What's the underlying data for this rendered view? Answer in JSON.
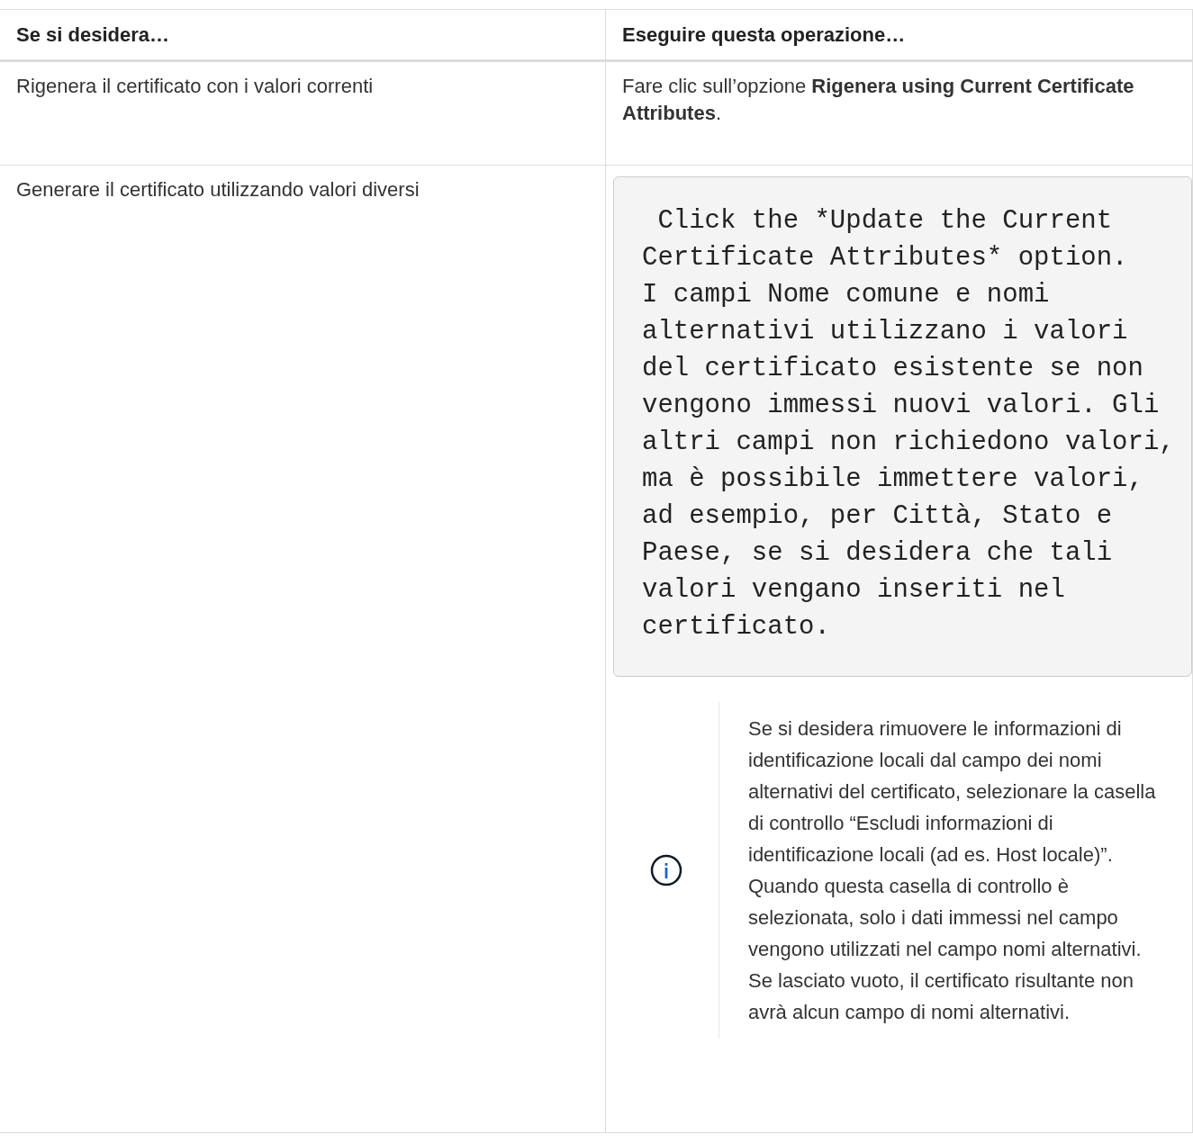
{
  "table": {
    "columns": [
      "Se si desidera…",
      "Eseguire questa operazione…"
    ],
    "rows": [
      {
        "action": "Rigenera il certificato con i valori correnti",
        "instruction": "Fare clic sull’opzione **Rigenera using Current Certificate Attributes**."
      },
      {
        "action": "Generare il certificato utilizzando valori diversi",
        "code": " Click the *Update the Current Certificate Attributes* option.\nI campi Nome comune e nomi alternativi utilizzano i valori del certificato esistente se non vengono immessi nuovi valori. Gli altri campi non richiedono valori, ma è possibile immettere valori, ad esempio, per Città, Stato e Paese, se si desidera che tali valori vengano inseriti nel certificato.",
        "note": "Se si desidera rimuovere le informazioni di identificazione locali dal campo dei nomi alternativi del certificato, selezionare la casella di controllo “Escludi informazioni di identificazione locali (ad es. Host locale)”. Quando questa casella di controllo è selezionata, solo i dati immessi nel campo vengono utilizzati nel campo nomi alternativi. Se lasciato vuoto, il certificato risultante non avrà alcun campo di nomi alternativi."
      }
    ]
  }
}
